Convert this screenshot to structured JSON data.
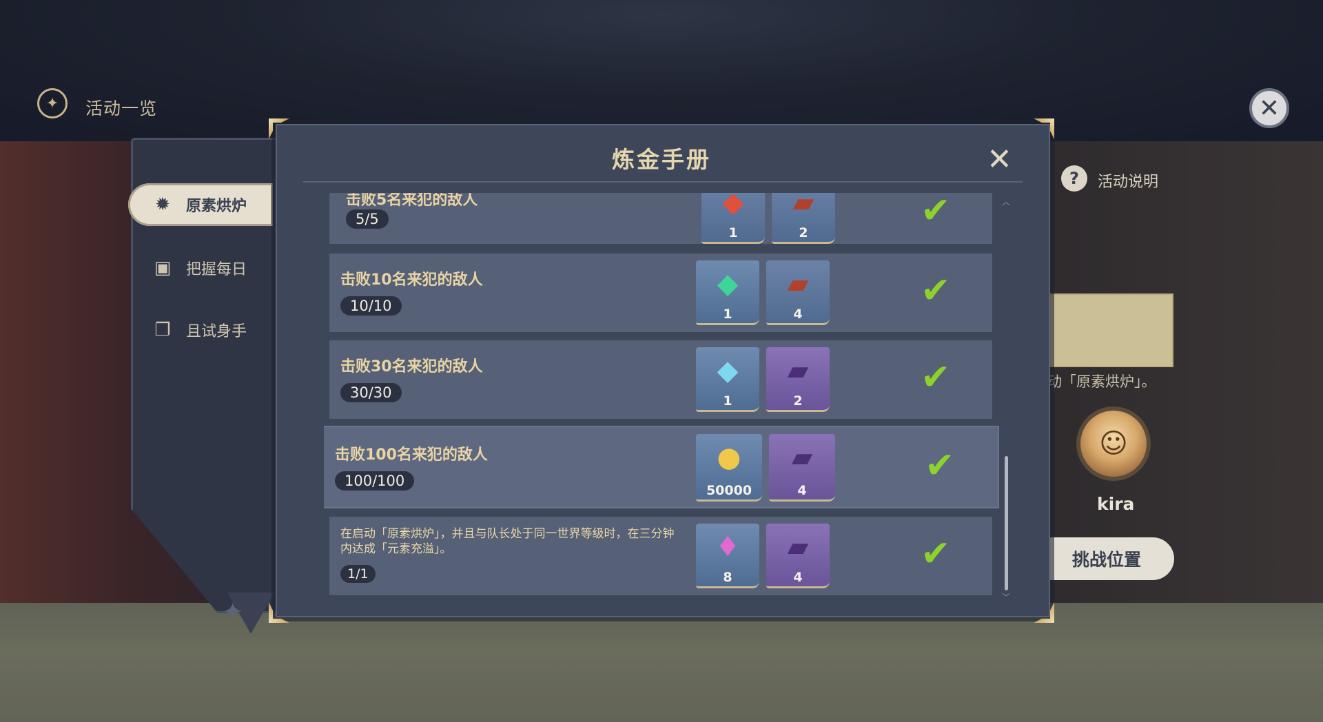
{
  "event_header": {
    "title": "活动一览"
  },
  "nav": {
    "items": [
      {
        "label": "原素烘炉",
        "icon": "furnace-icon",
        "active": true
      },
      {
        "label": "把握每日",
        "icon": "calendar-icon",
        "active": false
      },
      {
        "label": "且试身手",
        "icon": "cards-icon",
        "active": false
      }
    ]
  },
  "side": {
    "help_label": "活动说明",
    "hint_text": "动「原素烘炉」。",
    "player_name": "kira",
    "challenge_label": "挑战位置"
  },
  "modal": {
    "title": "炼金手册",
    "rows": [
      {
        "title": "击败5名来犯的敌人",
        "progress": "5/5",
        "rewards": [
          {
            "icon": "red-gem-icon",
            "qty": "1"
          },
          {
            "icon": "red-book-icon",
            "qty": "2"
          }
        ],
        "completed": true
      },
      {
        "title": "击败10名来犯的敌人",
        "progress": "10/10",
        "rewards": [
          {
            "icon": "green-gem-icon",
            "qty": "1"
          },
          {
            "icon": "red-book-icon",
            "qty": "4"
          }
        ],
        "completed": true
      },
      {
        "title": "击败30名来犯的敌人",
        "progress": "30/30",
        "rewards": [
          {
            "icon": "blue-gem-icon",
            "qty": "1"
          },
          {
            "icon": "purple-book-icon",
            "qty": "2"
          }
        ],
        "completed": true
      },
      {
        "title": "击败100名来犯的敌人",
        "progress": "100/100",
        "rewards": [
          {
            "icon": "mora-coin-icon",
            "qty": "50000"
          },
          {
            "icon": "purple-book-icon",
            "qty": "4"
          }
        ],
        "completed": true
      },
      {
        "title": "在启动「原素烘炉」，并且与队长处于同一世界等级时，在三分钟内达成「元素充溢」。",
        "progress": "1/1",
        "rewards": [
          {
            "icon": "crystal-icon",
            "qty": "8"
          },
          {
            "icon": "purple-book-icon",
            "qty": "4"
          }
        ],
        "completed": true
      }
    ]
  },
  "colors": {
    "accent_gold": "#e5d6ae",
    "check_green": "#8dd12c",
    "panel": "#3e4659"
  }
}
